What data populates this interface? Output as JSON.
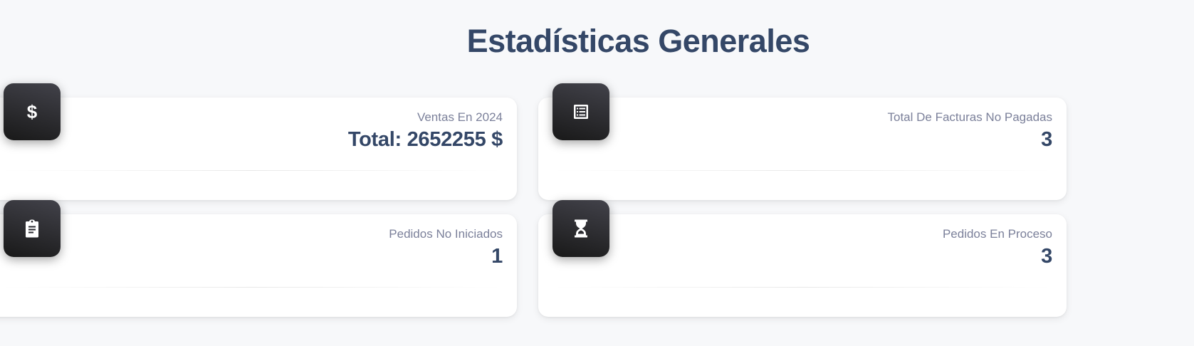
{
  "header": {
    "title": "Estadísticas Generales"
  },
  "cards": [
    {
      "icon": "dollar-icon",
      "icon_glyph": "$",
      "label": "Ventas En 2024",
      "value": "Total: 2652255 $"
    },
    {
      "icon": "receipt-list-icon",
      "label": "Total De Facturas No Pagadas",
      "value": "3"
    },
    {
      "icon": "clipboard-icon",
      "label": "Pedidos No Iniciados",
      "value": "1"
    },
    {
      "icon": "hourglass-icon",
      "label": "Pedidos En Proceso",
      "value": "3"
    }
  ],
  "colors": {
    "background": "#f7f8fa",
    "title": "#344767",
    "label": "#7b809a",
    "icon_bg_dark": "#191919",
    "icon_bg_light": "#42424a",
    "card_bg": "#ffffff"
  }
}
